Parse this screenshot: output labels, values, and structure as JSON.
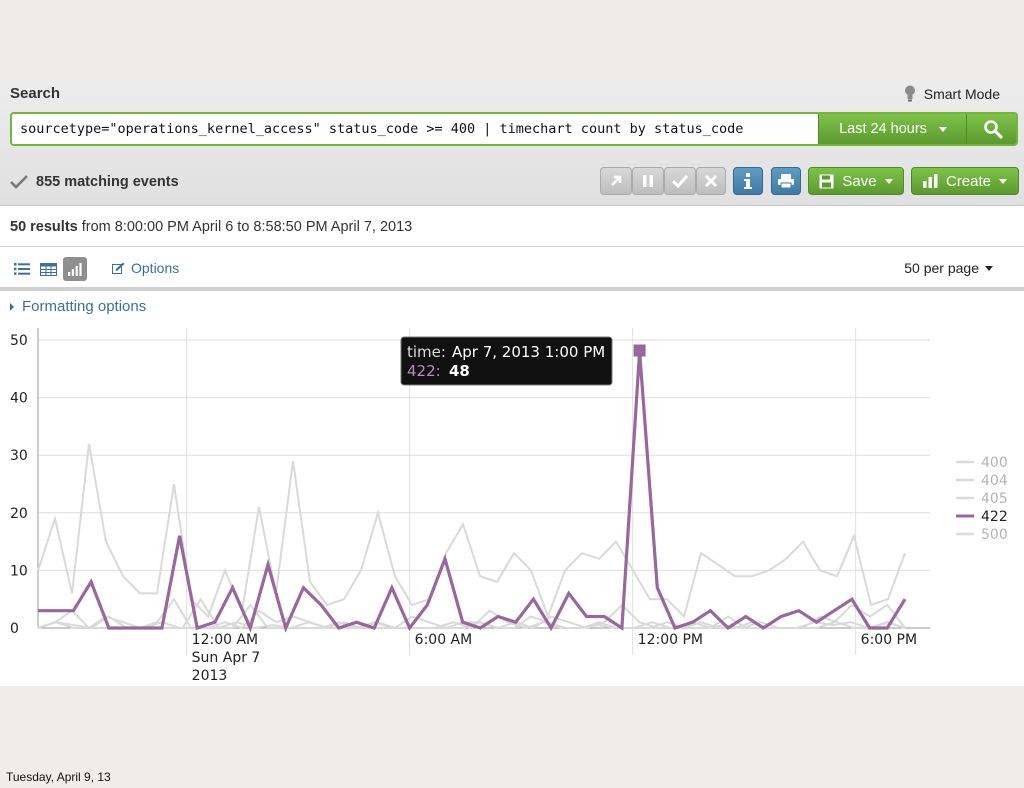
{
  "search": {
    "title": "Search",
    "mode_label": "Smart Mode",
    "query": "sourcetype=\"operations_kernel_access\" status_code >= 400 | timechart count by status_code",
    "time_range": "Last 24 hours"
  },
  "status": {
    "matching_events": "855 matching events"
  },
  "toolbar": {
    "save_label": "Save",
    "create_label": "Create"
  },
  "results": {
    "count": "50 results",
    "range": "from 8:00:00 PM April 6 to 8:58:50 PM April 7, 2013"
  },
  "viewbar": {
    "options_label": "Options",
    "per_page": "50 per page"
  },
  "formatting": {
    "label": "Formatting options"
  },
  "tooltip": {
    "time_key": "time:",
    "time_value": "Apr 7, 2013 1:00 PM",
    "series_key": "422:",
    "series_value": "48"
  },
  "footer": {
    "date": "Tuesday, April 9, 13"
  },
  "colors": {
    "accent_green": "#6aad3a",
    "series_422": "#98679c",
    "series_other": "#d9d9d9",
    "link_blue": "#3b6f99"
  },
  "chart_data": {
    "type": "line",
    "ylim": [
      0,
      50
    ],
    "yticks": [
      "0",
      "10",
      "20",
      "30",
      "40",
      "50"
    ],
    "xticks": [
      {
        "idx": 4,
        "lines": [
          "12:00 AM",
          "Sun Apr 7",
          "2013"
        ]
      },
      {
        "idx": 10,
        "lines": [
          "6:00 AM"
        ]
      },
      {
        "idx": 16,
        "lines": [
          "12:00 PM"
        ]
      },
      {
        "idx": 22,
        "lines": [
          "6:00 PM"
        ]
      }
    ],
    "x_count": 25,
    "highlight": {
      "series": "422",
      "index": 17
    },
    "series": [
      {
        "name": "400",
        "highlight": false,
        "values": [
          0,
          1,
          0.5,
          0,
          0,
          0,
          0,
          0,
          0,
          5,
          0,
          1,
          0,
          0.5,
          0,
          1,
          0,
          0,
          0,
          0,
          0,
          0,
          0,
          1,
          0,
          3,
          1,
          0,
          1,
          0,
          0,
          0.5,
          0,
          0,
          1,
          0,
          0,
          0,
          0.5,
          0,
          1,
          0,
          0,
          1,
          0.5,
          1,
          0,
          1,
          0
        ]
      },
      {
        "name": "404",
        "highlight": false,
        "values": [
          10,
          19,
          6,
          32,
          15,
          9,
          6,
          6,
          25,
          5,
          2,
          10,
          3,
          21,
          6,
          29,
          8,
          4,
          5,
          10,
          20,
          9,
          4,
          5,
          13,
          18,
          9,
          8,
          13,
          10,
          2,
          10,
          13,
          12,
          15,
          10,
          5,
          5,
          2,
          13,
          11,
          9,
          9,
          10,
          12,
          15,
          10,
          9,
          16,
          4,
          5,
          13
        ]
      },
      {
        "name": "405",
        "highlight": false,
        "values": [
          0,
          1,
          3,
          0,
          2,
          1,
          0,
          1,
          5,
          0,
          0,
          1,
          0,
          3,
          1,
          2,
          1,
          0,
          1,
          0,
          1,
          0,
          2,
          1,
          0,
          1,
          1,
          0,
          0,
          2,
          1,
          0,
          0,
          1,
          0,
          0,
          0,
          1,
          0,
          1,
          0,
          0,
          1,
          0,
          0,
          0,
          2,
          1,
          0,
          0,
          1,
          0
        ]
      },
      {
        "name": "422",
        "highlight": true,
        "values": [
          3,
          3,
          3,
          8,
          0,
          0,
          0,
          0,
          16,
          0,
          1,
          7,
          0,
          11,
          0,
          7,
          4,
          0,
          1,
          0,
          7,
          0,
          4,
          12,
          1,
          0,
          2,
          1,
          5,
          0,
          6,
          2,
          2,
          0,
          48,
          7,
          0,
          1,
          3,
          0,
          2,
          0,
          2,
          3,
          1,
          3,
          5,
          0,
          0,
          5
        ]
      },
      {
        "name": "500",
        "highlight": false,
        "values": [
          0,
          1,
          0,
          0,
          2,
          0,
          0,
          1,
          0,
          0,
          0,
          0,
          4,
          0,
          0,
          0,
          0,
          1,
          0,
          1,
          0,
          0,
          0,
          0,
          0,
          1,
          0,
          1,
          0,
          2,
          1,
          0,
          1,
          4,
          1,
          0,
          0,
          1,
          0,
          2,
          0,
          0,
          0,
          0,
          0,
          1,
          4,
          2,
          4,
          0
        ]
      }
    ]
  }
}
